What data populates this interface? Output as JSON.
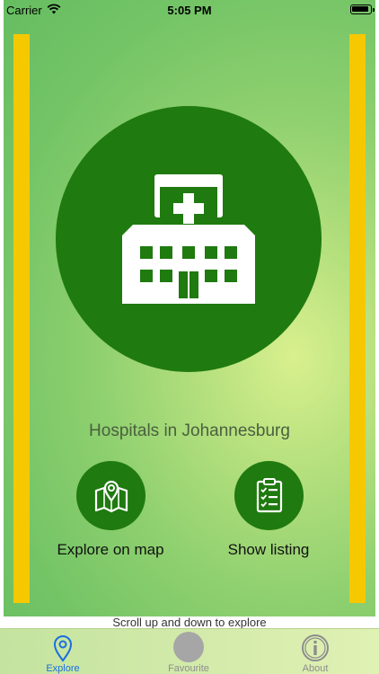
{
  "status_bar": {
    "carrier": "Carrier",
    "time": "5:05 PM"
  },
  "hero": {
    "icon": "hospital-building-icon",
    "title": "Hospitals in Johannesburg"
  },
  "actions": [
    {
      "icon": "map-pin-icon",
      "label": "Explore on map"
    },
    {
      "icon": "clipboard-list-icon",
      "label": "Show listing"
    }
  ],
  "hint": "Scroll up and down to explore",
  "tabs": [
    {
      "icon": "location-pin-icon",
      "label": "Explore",
      "selected": true
    },
    {
      "icon": "circle-placeholder-icon",
      "label": "Favourite",
      "selected": false
    },
    {
      "icon": "info-icon",
      "label": "About",
      "selected": false
    }
  ],
  "colors": {
    "accent_green": "#1f7a0f",
    "stripe_yellow": "#f6c800",
    "selected_tab": "#1a6fe0"
  }
}
